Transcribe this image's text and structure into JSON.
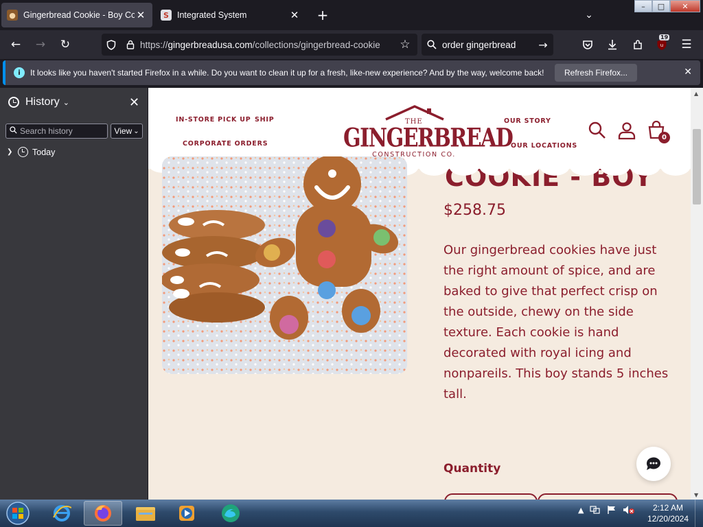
{
  "browser": {
    "tabs": [
      {
        "title": "Gingerbread Cookie - Boy Cookie",
        "active": true
      },
      {
        "title": "Integrated System",
        "active": false
      }
    ],
    "url_prefix": "https://",
    "url_host": "gingerbreadusa.com",
    "url_path": "/collections/gingerbread-cookie",
    "search_query": "order gingerbread",
    "extension_badge": "19"
  },
  "notification": {
    "message": "It looks like you haven't started Firefox in a while. Do you want to clean it up for a fresh, like-new experience? And by the way, welcome back!",
    "button": "Refresh Firefox..."
  },
  "sidebar": {
    "title": "History",
    "search_placeholder": "Search history",
    "view_label": "View",
    "groups": [
      {
        "label": "Today"
      }
    ]
  },
  "site": {
    "nav_left": [
      "IN-STORE PICK UP",
      "SHIP",
      "CORPORATE ORDERS"
    ],
    "nav_right": [
      "OUR STORY",
      "OUR LOCATIONS"
    ],
    "logo": {
      "the": "THE",
      "name": "GINGERBREAD",
      "sub": "CONSTRUCTION CO."
    },
    "cart_count": "0",
    "brand_color": "#8b1e2d",
    "background_color": "#f5ebe0"
  },
  "product": {
    "title_partial": "COOKIE - BOY",
    "price": "$258.75",
    "description": "Our gingerbread cookies have just the right amount of spice, and are baked to give that perfect crisp on the outside, chewy on the side texture. Each cookie is hand decorated with royal icing and nonpareils. This boy stands 5 inches tall.",
    "quantity_label": "Quantity"
  },
  "taskbar": {
    "time": "2:12 AM",
    "date": "12/20/2024",
    "apps": [
      "internet-explorer",
      "firefox",
      "file-explorer",
      "media-player",
      "edge"
    ]
  }
}
